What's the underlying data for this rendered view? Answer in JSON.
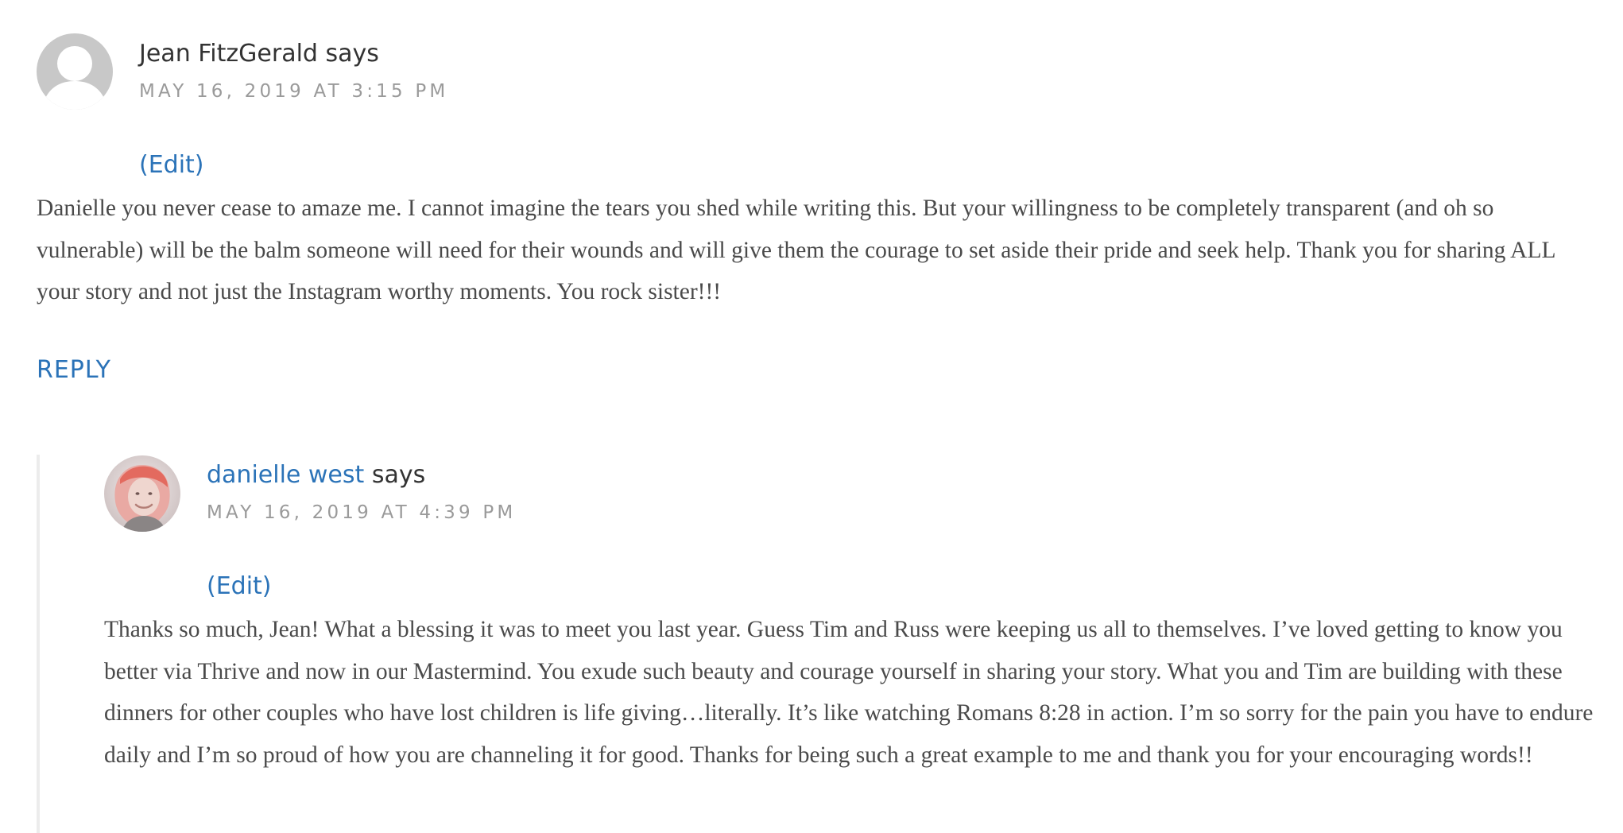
{
  "comments": [
    {
      "author": "Jean FitzGerald",
      "says": "says",
      "date": "MAY 16, 2019 AT 3:15 PM",
      "edit_label": "(Edit)",
      "text": "Danielle you never cease to amaze me. I cannot imagine the tears you shed while writing this. But your willingness to be completely transparent (and oh so vulnerable) will be the balm someone will need for their wounds and will give them the courage to set aside their pride and seek help. Thank you for sharing ALL your story and not just the Instagram worthy moments. You rock sister!!!",
      "reply_label": "REPLY",
      "avatar_icon": "default-user-avatar"
    },
    {
      "author": "danielle west",
      "says": "says",
      "date": "MAY 16, 2019 AT 4:39 PM",
      "edit_label": "(Edit)",
      "text": "Thanks so much, Jean! What a blessing it was to meet you last year. Guess Tim and Russ were keeping us all to themselves. I’ve loved getting to know you better via Thrive and now in our Mastermind. You exude such beauty and courage yourself in sharing your story. What you and Tim are building with these dinners for other couples who have lost children is life giving…literally. It’s like watching Romans 8:28 in action. I’m so sorry for the pain you have to endure daily and I’m so proud of how you are channeling it for good. Thanks for being such a great example to me and thank you for your encouraging words!!",
      "avatar_icon": "user-photo-avatar"
    }
  ],
  "colors": {
    "link": "#2b73b8",
    "body_text": "#4a4a4a",
    "date_text": "#9a9a9a",
    "author_text": "#333333",
    "avatar_placeholder": "#c8c8c8",
    "thread_rule": "#ececec"
  }
}
